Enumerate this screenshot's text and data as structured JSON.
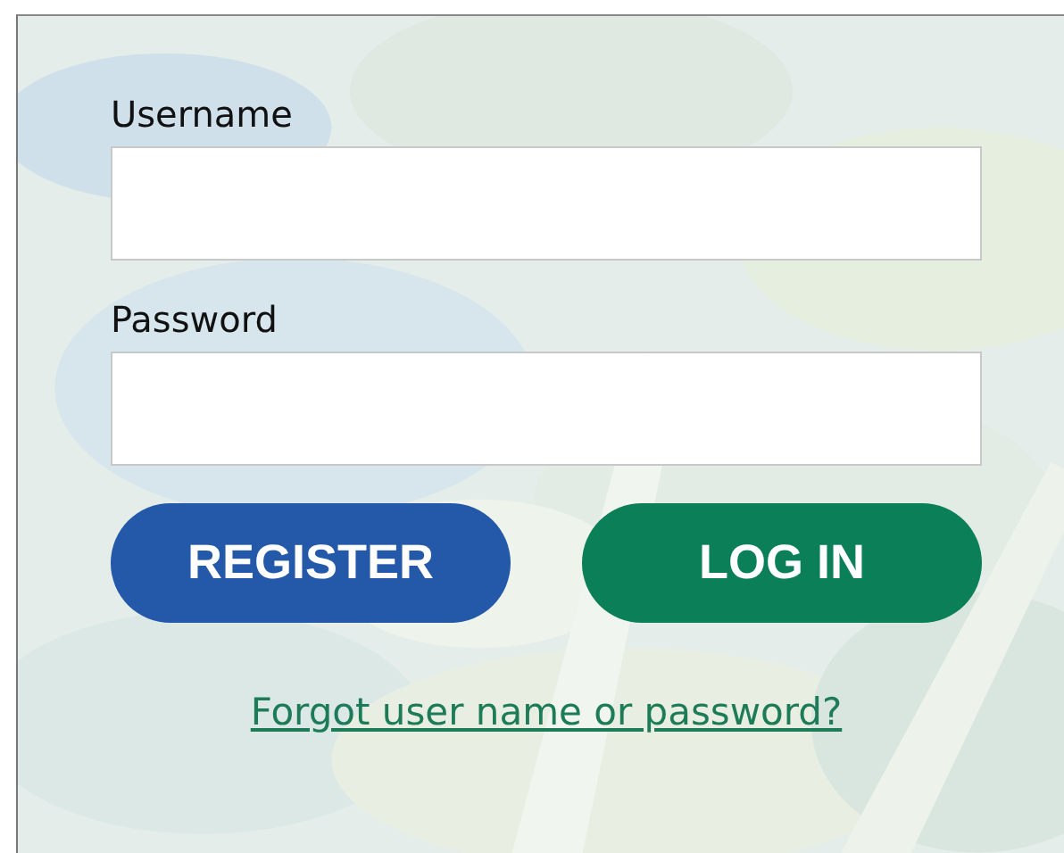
{
  "fields": [
    {
      "label": "Username"
    },
    {
      "label": "Password"
    }
  ],
  "buttons": [
    {
      "label": "REGISTER",
      "kind": "secondary"
    },
    {
      "label": "LOG IN",
      "kind": "primary"
    }
  ],
  "link": "Forgot user name or password?"
}
